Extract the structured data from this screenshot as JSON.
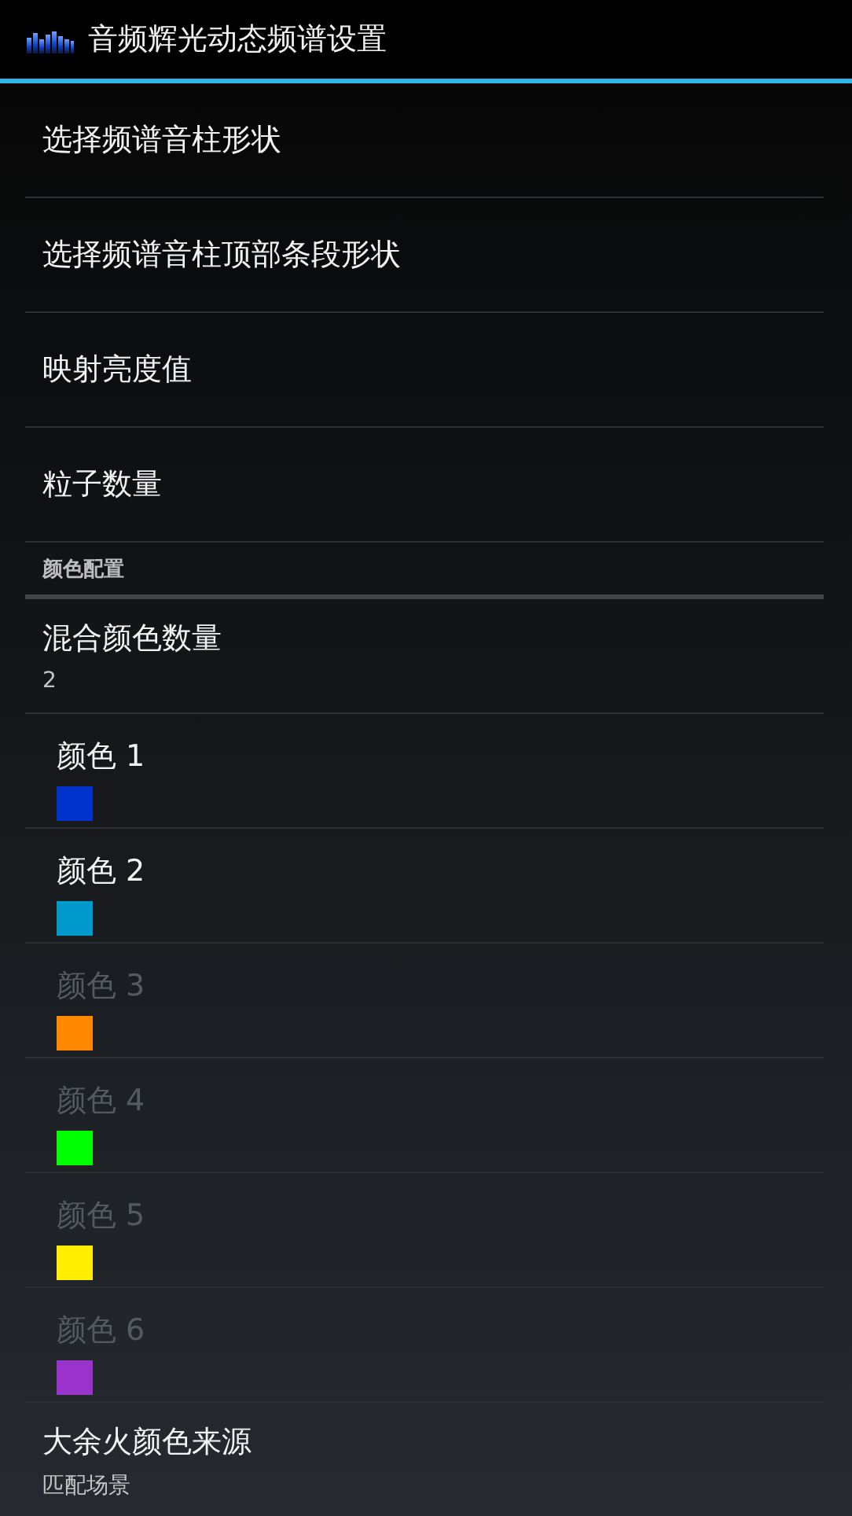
{
  "action_bar": {
    "title": "音频辉光动态频谱设置"
  },
  "items": [
    {
      "kind": "plain",
      "title": "选择频谱音柱形状"
    },
    {
      "kind": "plain",
      "title": "选择频谱音柱顶部条段形状"
    },
    {
      "kind": "plain",
      "title": "映射亮度值"
    },
    {
      "kind": "plain",
      "title": "粒子数量"
    },
    {
      "kind": "category",
      "title": "颜色配置"
    },
    {
      "kind": "summary",
      "title": "混合颜色数量",
      "summary": "2",
      "disabled": false
    },
    {
      "kind": "color",
      "title": "颜色 1",
      "color": "#0033cc",
      "disabled": false
    },
    {
      "kind": "color",
      "title": "颜色 2",
      "color": "#0099cc",
      "disabled": false
    },
    {
      "kind": "color",
      "title": "颜色 3",
      "color": "#ff8800",
      "disabled": true
    },
    {
      "kind": "color",
      "title": "颜色 4",
      "color": "#00ff00",
      "disabled": true
    },
    {
      "kind": "color",
      "title": "颜色 5",
      "color": "#ffee00",
      "disabled": true
    },
    {
      "kind": "color",
      "title": "颜色 6",
      "color": "#9933cc",
      "disabled": true
    },
    {
      "kind": "summary",
      "title": "大余火颜色来源",
      "summary": "匹配场景",
      "disabled": false
    }
  ]
}
